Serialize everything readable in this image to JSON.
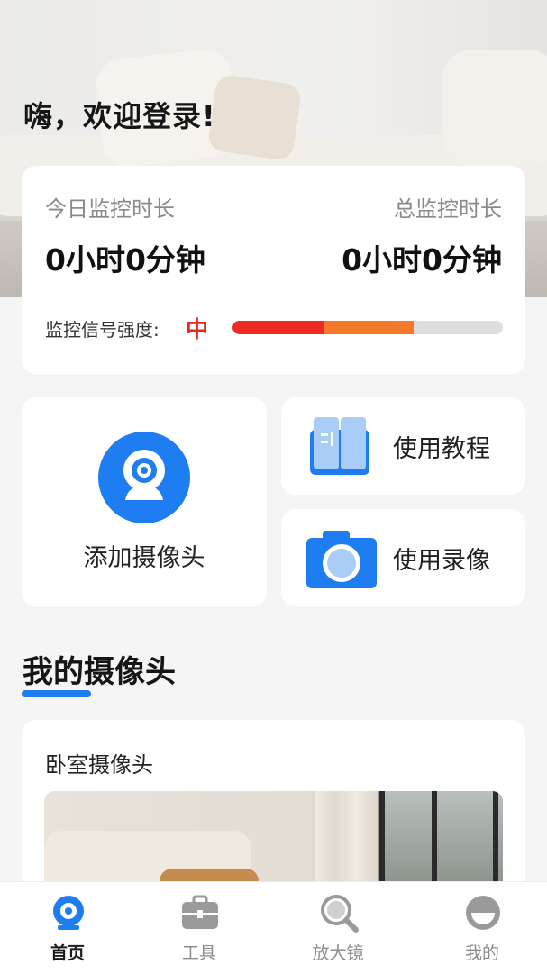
{
  "header": {
    "greeting": "嗨，欢迎登录!"
  },
  "stats": {
    "today_label": "今日监控时长",
    "today_value": "0小时0分钟",
    "total_label": "总监控时长",
    "total_value": "0小时0分钟",
    "signal_label": "监控信号强度:",
    "signal_level": "中",
    "signal_fraction": 0.67,
    "colors": {
      "strong": "#ee2a22",
      "medium": "#f5792a",
      "empty": "#dedede"
    }
  },
  "actions": {
    "add_camera": {
      "label": "添加摄像头",
      "icon": "camera-icon"
    },
    "tutorial": {
      "label": "使用教程",
      "icon": "book-icon"
    },
    "recording": {
      "label": "使用录像",
      "icon": "photo-camera-icon"
    }
  },
  "my_cameras": {
    "title": "我的摄像头",
    "items": [
      {
        "name": "卧室摄像头"
      }
    ]
  },
  "tabbar": {
    "items": [
      {
        "label": "首页",
        "icon": "home-camera-icon",
        "active": true
      },
      {
        "label": "工具",
        "icon": "toolbox-icon",
        "active": false
      },
      {
        "label": "放大镜",
        "icon": "magnifier-icon",
        "active": false
      },
      {
        "label": "我的",
        "icon": "profile-icon",
        "active": false
      }
    ]
  },
  "accent_color": "#1f7df2"
}
